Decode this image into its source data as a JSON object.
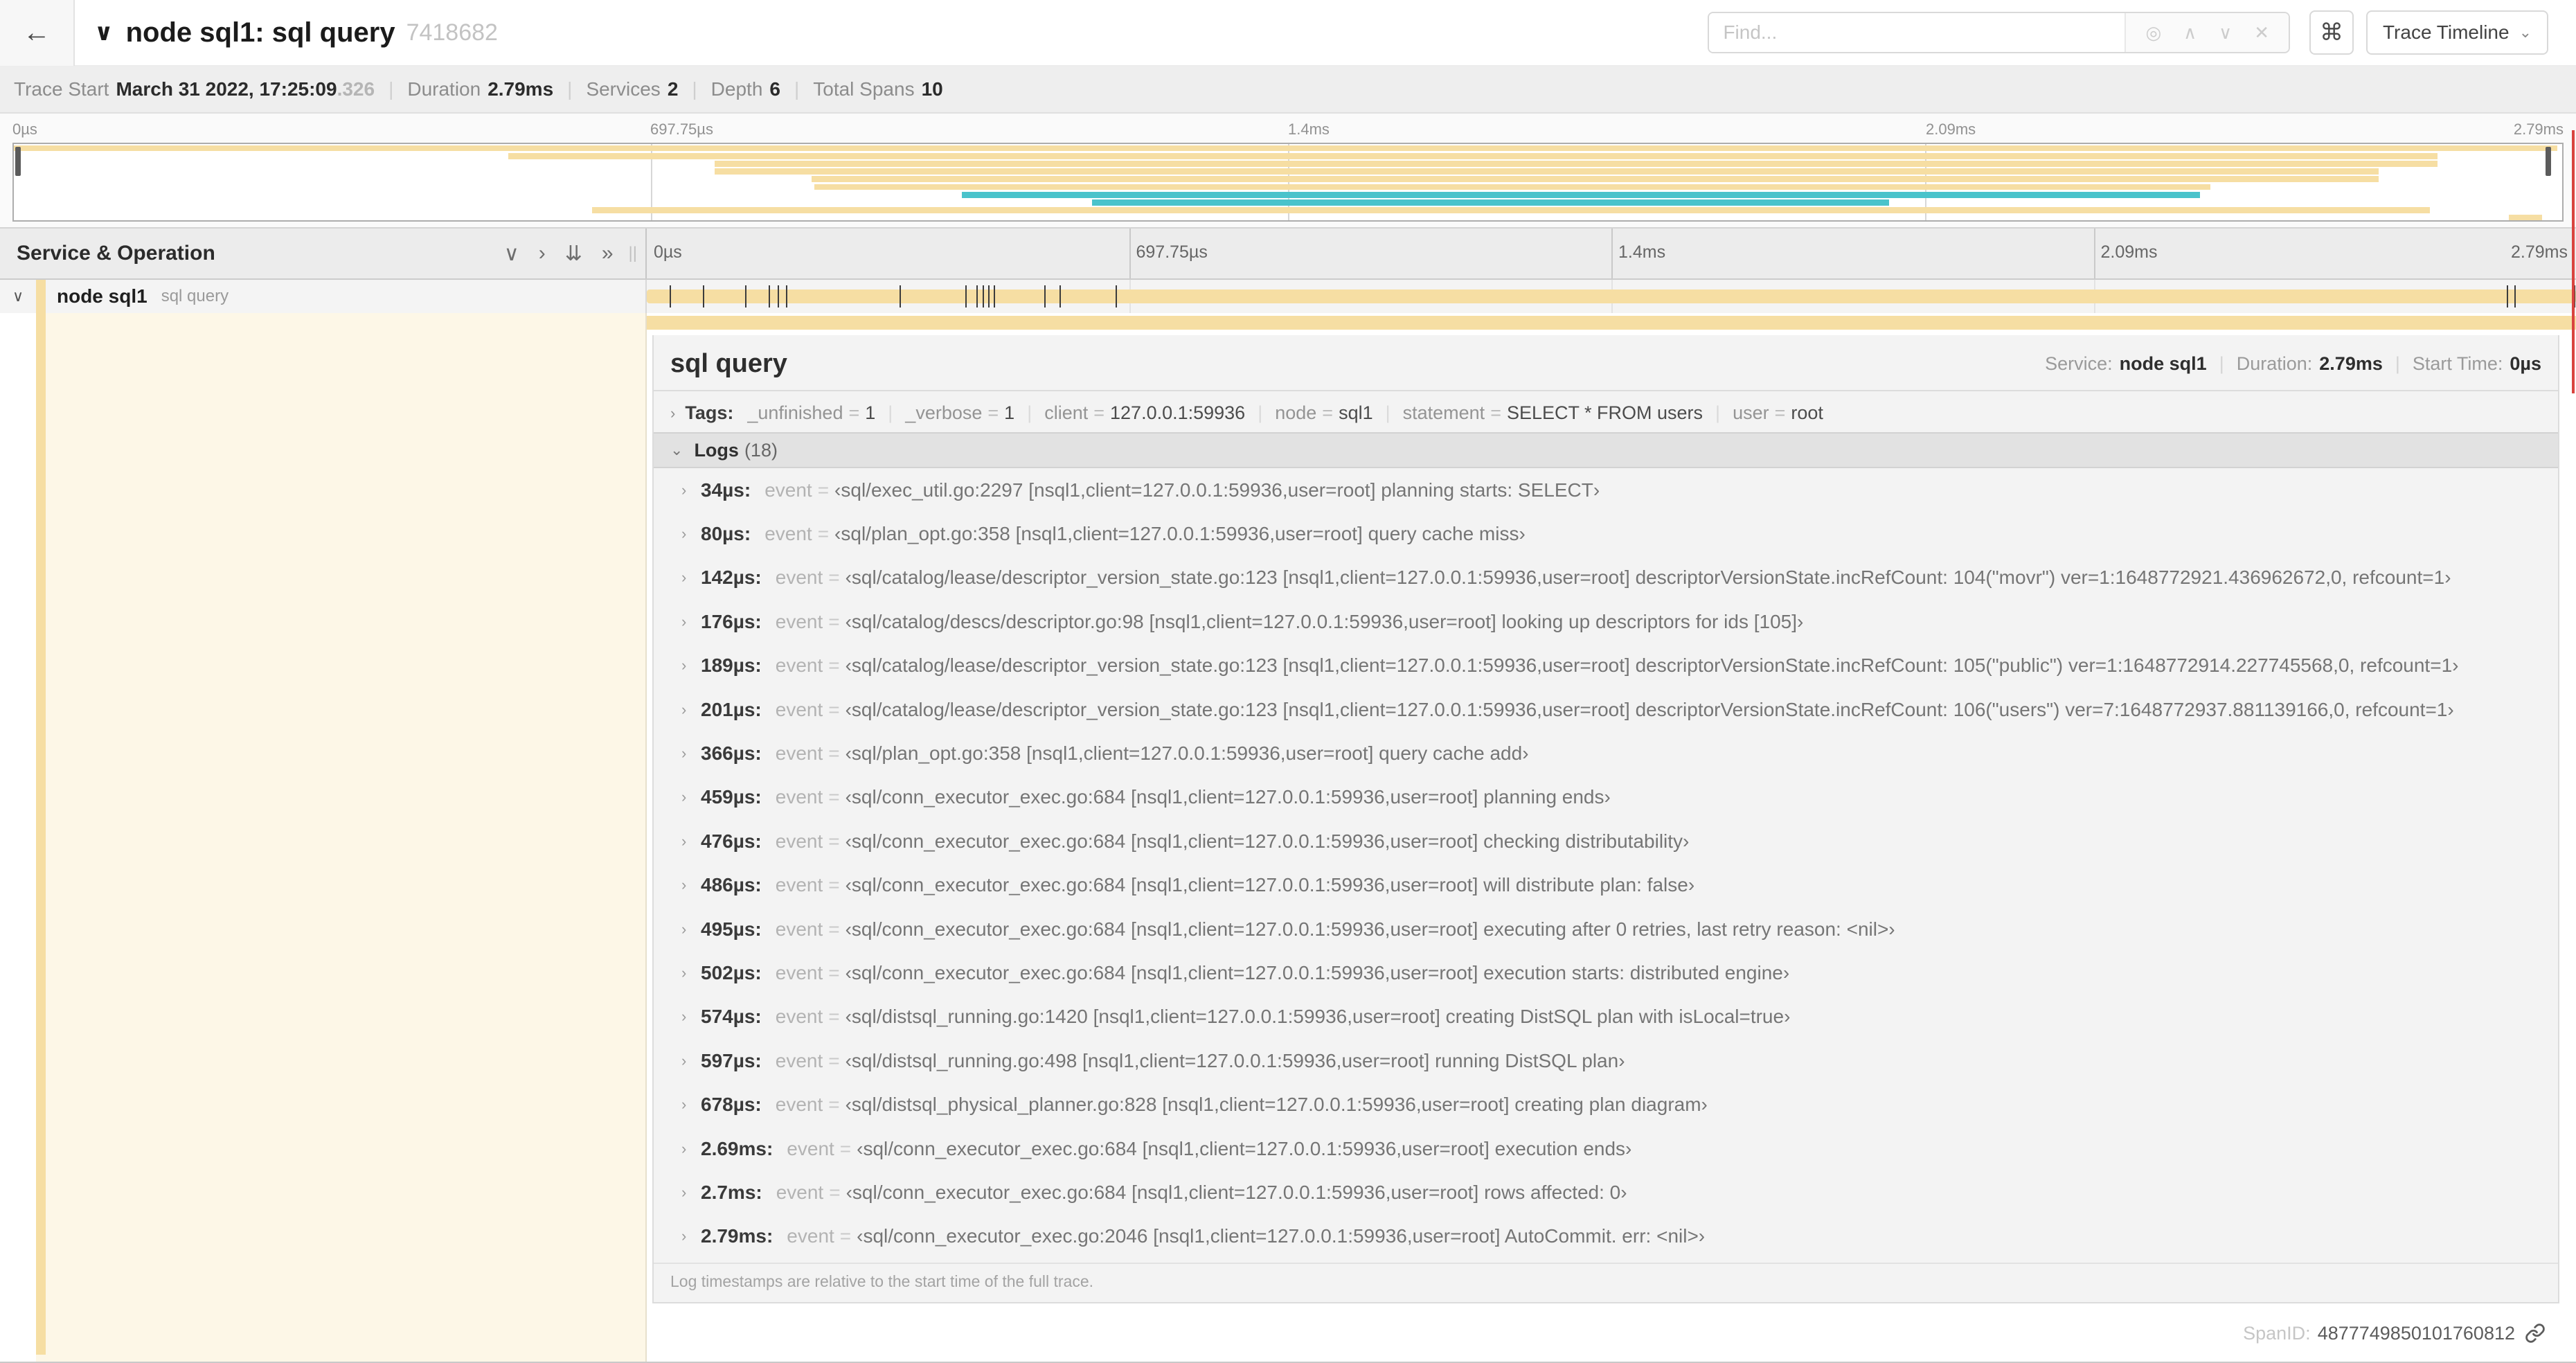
{
  "header": {
    "back_icon": "←",
    "collapse_icon": "∨",
    "title": "node sql1: sql query",
    "trace_id": "7418682",
    "find_placeholder": "Find...",
    "icons": {
      "locate": "◎",
      "prev": "∧",
      "next": "∨",
      "clear": "✕"
    },
    "kbd_label": "⌘",
    "view_label": "Trace Timeline",
    "view_caret": "⌄"
  },
  "summary": {
    "items": [
      {
        "label": "Trace Start",
        "value": "March 31 2022, 17:25:09",
        "suffix": ".326"
      },
      {
        "label": "Duration",
        "value": "2.79ms"
      },
      {
        "label": "Services",
        "value": "2"
      },
      {
        "label": "Depth",
        "value": "6"
      },
      {
        "label": "Total Spans",
        "value": "10"
      }
    ]
  },
  "colors": {
    "span_tan": "#f6dea3",
    "span_teal": "#4ac3cb",
    "guide_line": "#d9443f",
    "selected_row_bg": "#f4f4f4",
    "left_col_cream": "#fdf7e7"
  },
  "time_ticks": [
    "0µs",
    "697.75µs",
    "1.4ms",
    "2.09ms",
    "2.79ms"
  ],
  "tick_pcts": [
    0,
    25,
    50,
    75,
    100
  ],
  "grid_pcts": [
    25,
    50,
    75
  ],
  "minimap": {
    "spans": [
      {
        "row": 0,
        "start": 0,
        "end": 99.8,
        "color": "tan"
      },
      {
        "row": 1,
        "start": 19.4,
        "end": 95.1,
        "color": "tan"
      },
      {
        "row": 2,
        "start": 27.5,
        "end": 95.1,
        "color": "tan"
      },
      {
        "row": 3,
        "start": 27.5,
        "end": 92.8,
        "color": "tan"
      },
      {
        "row": 4,
        "start": 31.3,
        "end": 92.8,
        "color": "tan"
      },
      {
        "row": 5,
        "start": 31.4,
        "end": 86.2,
        "color": "tan"
      },
      {
        "row": 6,
        "start": 37.2,
        "end": 85.8,
        "color": "teal"
      },
      {
        "row": 7,
        "start": 42.3,
        "end": 73.6,
        "color": "teal"
      },
      {
        "row": 8,
        "start": 22.7,
        "end": 94.8,
        "color": "tan"
      },
      {
        "row": 9,
        "start": 97.9,
        "end": 99.2,
        "color": "tan"
      }
    ]
  },
  "timeline": {
    "left_title": "Service & Operation",
    "icon_collapse_one": "∨",
    "icon_expand_one": "›",
    "icon_collapse_all": "⇊",
    "icon_expand_all": "»",
    "grip": "||"
  },
  "span_row": {
    "caret": "∨",
    "service": "node sql1",
    "operation": "sql query",
    "bar_start": 0,
    "bar_end": 100,
    "log_tick_pcts": [
      1.2,
      2.9,
      5.1,
      6.3,
      6.8,
      7.2,
      13.1,
      16.5,
      17.1,
      17.4,
      17.7,
      18.0,
      20.6,
      21.4,
      24.3,
      96.4,
      96.8,
      99.9
    ]
  },
  "detail": {
    "title": "sql query",
    "meta": [
      {
        "label": "Service:",
        "value": "node sql1"
      },
      {
        "label": "Duration:",
        "value": "2.79ms"
      },
      {
        "label": "Start Time:",
        "value": "0µs"
      }
    ],
    "tags_caret": "›",
    "tags_label": "Tags:",
    "tags": [
      {
        "key": "_unfinished",
        "value": "1"
      },
      {
        "key": "_verbose",
        "value": "1"
      },
      {
        "key": "client",
        "value": "127.0.0.1:59936"
      },
      {
        "key": "node",
        "value": "sql1"
      },
      {
        "key": "statement",
        "value": "SELECT * FROM users"
      },
      {
        "key": "user",
        "value": "root"
      }
    ],
    "logs_caret": "⌄",
    "logs_label": "Logs",
    "logs_count": "(18)",
    "log_field_key": "event",
    "logs": [
      {
        "time": "34µs:",
        "event": "‹sql/exec_util.go:2297 [nsql1,client=127.0.0.1:59936,user=root] planning starts: SELECT›"
      },
      {
        "time": "80µs:",
        "event": "‹sql/plan_opt.go:358 [nsql1,client=127.0.0.1:59936,user=root] query cache miss›"
      },
      {
        "time": "142µs:",
        "event": "‹sql/catalog/lease/descriptor_version_state.go:123 [nsql1,client=127.0.0.1:59936,user=root] descriptorVersionState.incRefCount: 104(\"movr\") ver=1:1648772921.436962672,0, refcount=1›"
      },
      {
        "time": "176µs:",
        "event": "‹sql/catalog/descs/descriptor.go:98 [nsql1,client=127.0.0.1:59936,user=root] looking up descriptors for ids [105]›"
      },
      {
        "time": "189µs:",
        "event": "‹sql/catalog/lease/descriptor_version_state.go:123 [nsql1,client=127.0.0.1:59936,user=root] descriptorVersionState.incRefCount: 105(\"public\") ver=1:1648772914.227745568,0, refcount=1›"
      },
      {
        "time": "201µs:",
        "event": "‹sql/catalog/lease/descriptor_version_state.go:123 [nsql1,client=127.0.0.1:59936,user=root] descriptorVersionState.incRefCount: 106(\"users\") ver=7:1648772937.881139166,0, refcount=1›"
      },
      {
        "time": "366µs:",
        "event": "‹sql/plan_opt.go:358 [nsql1,client=127.0.0.1:59936,user=root] query cache add›"
      },
      {
        "time": "459µs:",
        "event": "‹sql/conn_executor_exec.go:684 [nsql1,client=127.0.0.1:59936,user=root] planning ends›"
      },
      {
        "time": "476µs:",
        "event": "‹sql/conn_executor_exec.go:684 [nsql1,client=127.0.0.1:59936,user=root] checking distributability›"
      },
      {
        "time": "486µs:",
        "event": "‹sql/conn_executor_exec.go:684 [nsql1,client=127.0.0.1:59936,user=root] will distribute plan: false›"
      },
      {
        "time": "495µs:",
        "event": "‹sql/conn_executor_exec.go:684 [nsql1,client=127.0.0.1:59936,user=root] executing after 0 retries, last retry reason: <nil>›"
      },
      {
        "time": "502µs:",
        "event": "‹sql/conn_executor_exec.go:684 [nsql1,client=127.0.0.1:59936,user=root] execution starts: distributed engine›"
      },
      {
        "time": "574µs:",
        "event": "‹sql/distsql_running.go:1420 [nsql1,client=127.0.0.1:59936,user=root] creating DistSQL plan with isLocal=true›"
      },
      {
        "time": "597µs:",
        "event": "‹sql/distsql_running.go:498 [nsql1,client=127.0.0.1:59936,user=root] running DistSQL plan›"
      },
      {
        "time": "678µs:",
        "event": "‹sql/distsql_physical_planner.go:828 [nsql1,client=127.0.0.1:59936,user=root] creating plan diagram›"
      },
      {
        "time": "2.69ms:",
        "event": "‹sql/conn_executor_exec.go:684 [nsql1,client=127.0.0.1:59936,user=root] execution ends›"
      },
      {
        "time": "2.7ms:",
        "event": "‹sql/conn_executor_exec.go:684 [nsql1,client=127.0.0.1:59936,user=root] rows affected: 0›"
      },
      {
        "time": "2.79ms:",
        "event": "‹sql/conn_executor_exec.go:2046 [nsql1,client=127.0.0.1:59936,user=root] AutoCommit. err: <nil>›"
      }
    ],
    "note": "Log timestamps are relative to the start time of the full trace.",
    "span_id_label": "SpanID:",
    "span_id": "4877749850101760812"
  }
}
